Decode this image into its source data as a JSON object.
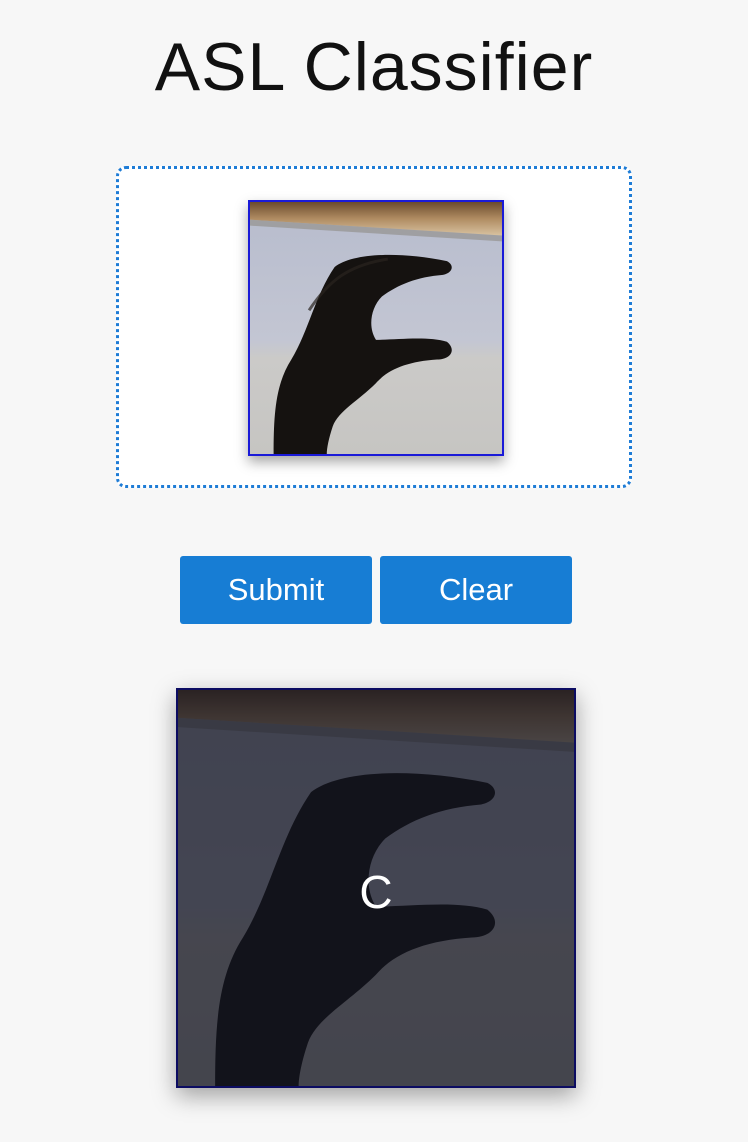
{
  "header": {
    "title": "ASL Classifier"
  },
  "upload": {
    "image_alt": "uploaded hand sign image"
  },
  "actions": {
    "submit_label": "Submit",
    "clear_label": "Clear"
  },
  "result": {
    "prediction": "C"
  },
  "colors": {
    "accent": "#177dd4",
    "dropzone_border": "#1e7cd6",
    "background": "#f7f7f7"
  }
}
